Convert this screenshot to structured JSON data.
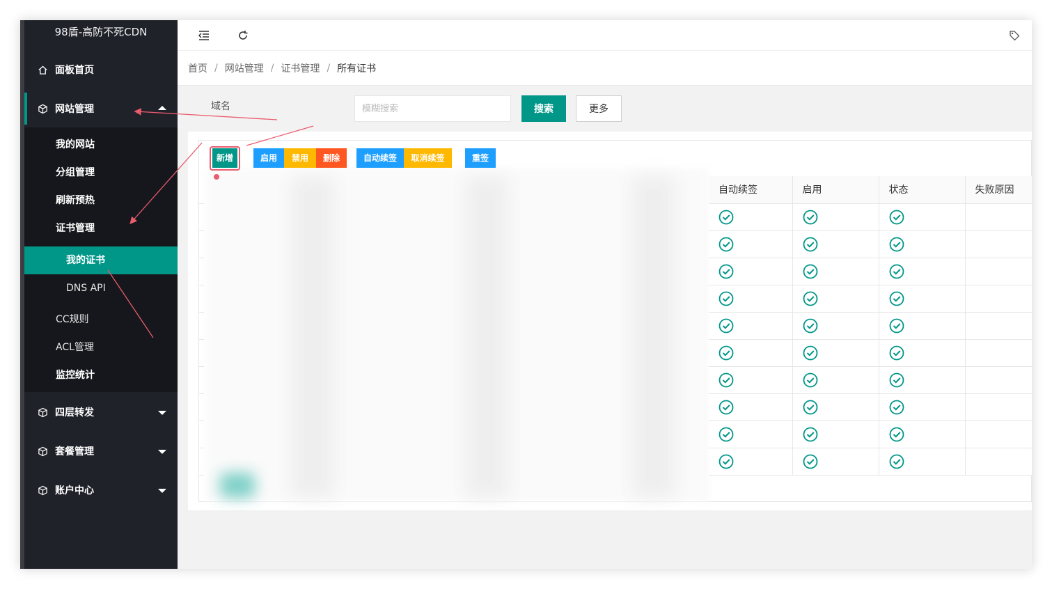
{
  "app": {
    "title": "98盾-高防不死CDN"
  },
  "sidebar": {
    "items": [
      {
        "label": "面板首页",
        "icon": "home-icon"
      },
      {
        "label": "网站管理",
        "icon": "cube-icon",
        "expanded": true
      },
      {
        "label": "四层转发",
        "icon": "cube-icon"
      },
      {
        "label": "套餐管理",
        "icon": "cube-icon"
      },
      {
        "label": "账户中心",
        "icon": "cube-icon"
      }
    ],
    "sub": {
      "my_site": "我的网站",
      "group": "分组管理",
      "refresh": "刷新预热",
      "cert": "证书管理",
      "my_cert": "我的证书",
      "dns_api": "DNS API",
      "cc": "CC规则",
      "acl": "ACL管理",
      "monitor": "监控统计"
    }
  },
  "breadcrumb": [
    "首页",
    "网站管理",
    "证书管理",
    "所有证书"
  ],
  "breadcrumb_sep": "/",
  "search": {
    "label": "域名",
    "placeholder": "模糊搜索",
    "search_button": "搜索",
    "more_button": "更多"
  },
  "toolbar": {
    "add": "新增",
    "enable": "启用",
    "disable": "禁用",
    "delete": "删除",
    "auto_renew": "自动续签",
    "cancel_renew": "取消续签",
    "resign": "重签"
  },
  "table": {
    "headers": [
      "自动续签",
      "启用",
      "状态",
      "失败原因"
    ],
    "row_count": 10
  },
  "colors": {
    "primary": "#009688",
    "blue": "#1e9fff",
    "orange": "#ffb800",
    "red": "#ff5722",
    "annotation": "#ea5b6e",
    "sidebar": "#20222a"
  }
}
